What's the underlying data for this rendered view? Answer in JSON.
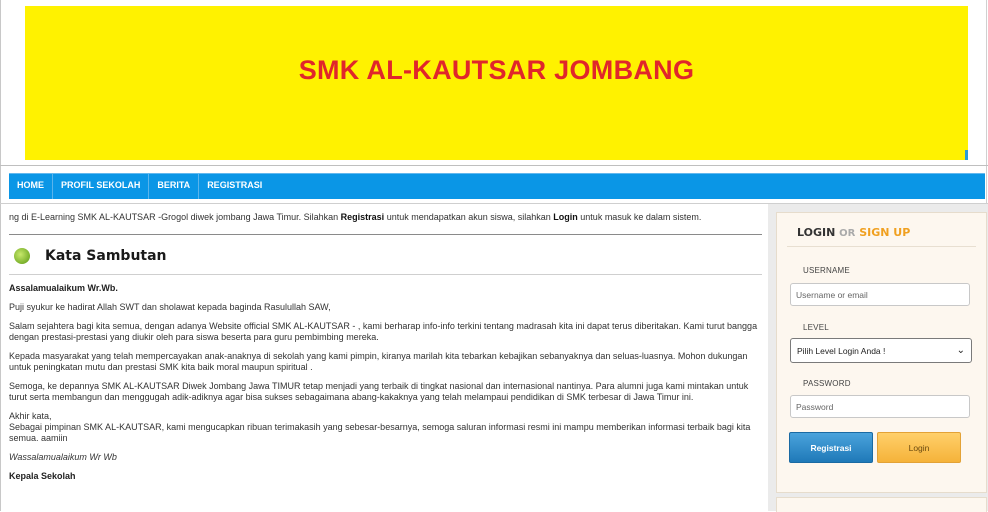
{
  "banner": {
    "title": "SMK AL-KAUTSAR JOMBANG"
  },
  "nav": {
    "items": [
      "HOME",
      "PROFIL SEKOLAH",
      "BERITA",
      "REGISTRASI"
    ]
  },
  "marquee": {
    "pre": "ng di E-Learning SMK AL-KAUTSAR -Grogol diwek jombang Jawa Timur. Silahkan ",
    "reg_word": "Registrasi",
    "mid": " untuk mendapatkan akun siswa, silahkan ",
    "login_word": "Login",
    "post": " untuk masuk ke dalam sistem."
  },
  "welcome": {
    "title": "Kata Sambutan",
    "greeting": "Assalamualaikum Wr.Wb.",
    "p1": "Puji syukur ke hadirat Allah SWT dan sholawat kepada baginda Rasulullah SAW,",
    "p2": "Salam sejahtera bagi kita semua, dengan adanya Website official SMK AL-KAUTSAR - , kami berharap info-info terkini tentang madrasah kita ini dapat terus diberitakan. Kami turut bangga dengan prestasi-prestasi yang diukir oleh para siswa beserta para guru pembimbing mereka.",
    "p3": "Kepada masyarakat yang telah mempercayakan anak-anaknya di sekolah yang kami pimpin, kiranya marilah kita tebarkan kebajikan sebanyaknya dan seluas-luasnya. Mohon dukungan untuk peningkatan mutu dan prestasi SMK kita baik moral maupun spiritual .",
    "p4": "Semoga, ke depannya SMK AL-KAUTSAR Diwek Jombang Jawa TIMUR tetap menjadi yang terbaik di tingkat nasional dan internasional nantinya. Para alumni juga kami mintakan untuk turut serta membangun dan menggugah adik-adiknya agar bisa sukses sebagaimana abang-kakaknya yang telah melampaui pendidikan di SMK terbesar di Jawa Timur ini.",
    "p5a": "Akhir kata,",
    "p5b": "Sebagai pimpinan SMK AL-KAUTSAR, kami mengucapkan ribuan terimakasih yang sebesar-besarnya, semoga saluran informasi resmi ini mampu memberikan informasi terbaik bagi kita semua. aamiin",
    "closing": "Wassalamualaikum Wr Wb",
    "signature": "Kepala Sekolah"
  },
  "login": {
    "head_login": "LOGIN",
    "head_or": "OR",
    "head_signup": "SIGN UP",
    "username_label": "USERNAME",
    "username_placeholder": "Username or email",
    "level_label": "LEVEL",
    "level_selected": "Pilih Level Login Anda !",
    "password_label": "PASSWORD",
    "password_placeholder": "Password",
    "btn_register": "Registrasi",
    "btn_login": "Login"
  },
  "colors": {
    "banner_bg": "#fff200",
    "banner_text": "#e0262b",
    "nav_bg": "#0a96e6",
    "signup_accent": "#f0a020"
  },
  "icons": {
    "welcome_icon": "green-circle-icon",
    "select_chevron": "chevron-down-icon"
  }
}
